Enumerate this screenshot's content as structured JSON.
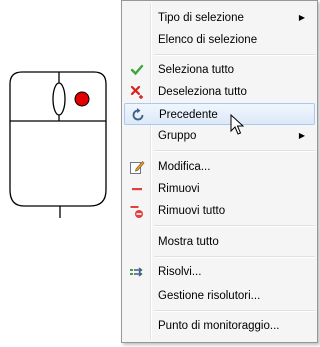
{
  "menu": {
    "items": [
      {
        "label": "Tipo di selezione",
        "icon": "none",
        "submenu": true
      },
      {
        "label": "Elenco di selezione",
        "icon": "none",
        "submenu": false
      },
      {
        "label": "Seleziona tutto",
        "icon": "green-checkmark-icon",
        "submenu": false
      },
      {
        "label": "Deseleziona tutto",
        "icon": "red-x-icon",
        "submenu": false
      },
      {
        "label": "Precedente",
        "icon": "undo-arrow-icon",
        "submenu": false,
        "highlighted": true
      },
      {
        "label": "Gruppo",
        "icon": "none",
        "submenu": true
      },
      {
        "label": "Modifica...",
        "icon": "edit-pencil-icon",
        "submenu": false
      },
      {
        "label": "Rimuovi",
        "icon": "red-minus-icon",
        "submenu": false
      },
      {
        "label": "Rimuovi tutto",
        "icon": "red-minus-multi-icon",
        "submenu": false
      },
      {
        "label": "Mostra tutto",
        "icon": "none",
        "submenu": false
      },
      {
        "label": "Risolvi...",
        "icon": "solve-arrows-icon",
        "submenu": false
      },
      {
        "label": "Gestione risolutori...",
        "icon": "none",
        "submenu": false
      },
      {
        "label": "Punto di monitoraggio...",
        "icon": "none",
        "submenu": false
      }
    ],
    "submenu_glyph": "▶"
  },
  "colors": {
    "highlight_border": "#aac9ee",
    "mouse_button": "#e00000"
  }
}
